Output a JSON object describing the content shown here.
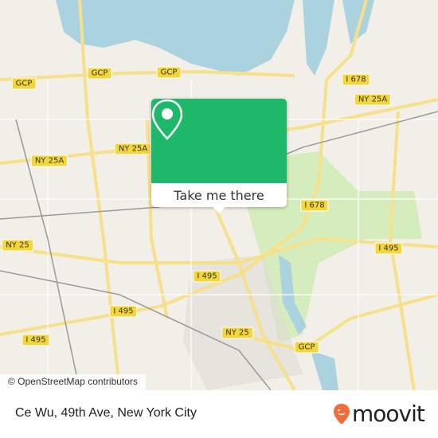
{
  "map": {
    "colors": {
      "land": "#f2efe9",
      "water": "#aad3df",
      "park": "#cdebb0",
      "road": "#f7e08a",
      "shield": "#f3d73a",
      "accent": "#1eb86a"
    },
    "shields": [
      "I 678",
      "GCP",
      "GCP",
      "GCP",
      "NY 25A",
      "NY 25A",
      "NY 25A",
      "I 678",
      "NY 25",
      "I 495",
      "I 495",
      "I 495",
      "NY 25",
      "GCP",
      "I 495"
    ],
    "attribution": "© OpenStreetMap contributors"
  },
  "popup": {
    "icon": "map-pin-icon",
    "button_label": "Take me there"
  },
  "footer": {
    "address": "Ce Wu, 49th Ave, New York City",
    "logo": "moovit"
  }
}
